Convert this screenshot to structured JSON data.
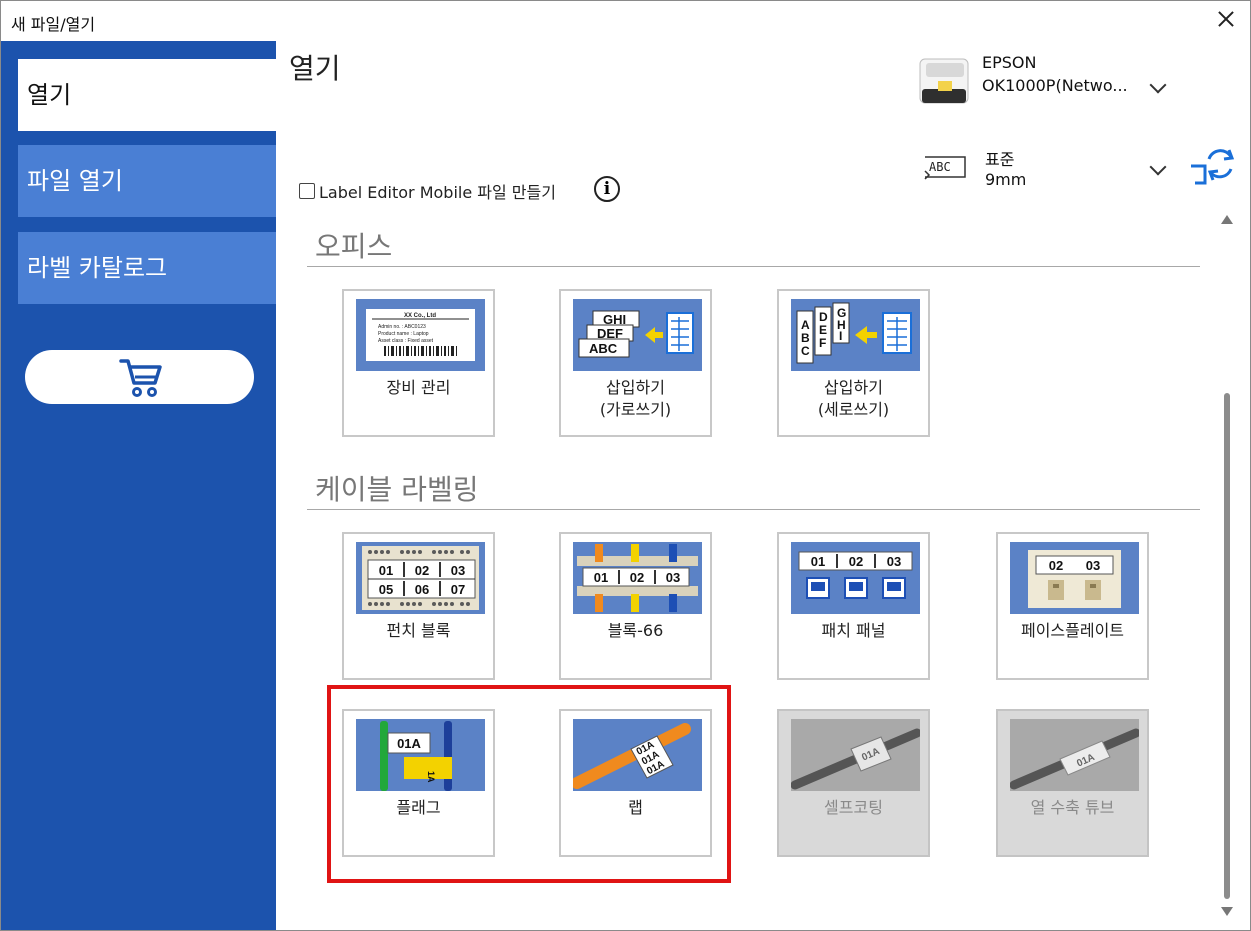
{
  "window": {
    "title": "새 파일/열기"
  },
  "sidebar": {
    "items": [
      {
        "label": "열기"
      },
      {
        "label": "파일 열기"
      },
      {
        "label": "라벨 카탈로그"
      }
    ]
  },
  "main": {
    "title": "열기",
    "printer": {
      "brand": "EPSON",
      "model": "OK1000P(Netwo..."
    },
    "tape": {
      "icon_text": "ABC",
      "type": "표준",
      "width": "9mm"
    },
    "label_editor_mobile": {
      "label": "Label Editor Mobile 파일 만들기",
      "checked": false
    },
    "sections": [
      {
        "title": "오피스",
        "tiles": [
          {
            "line1": "장비 관리",
            "line2": "",
            "enabled": true
          },
          {
            "line1": "삽입하기",
            "line2": "(가로쓰기)",
            "enabled": true
          },
          {
            "line1": "삽입하기",
            "line2": "(세로쓰기)",
            "enabled": true
          }
        ]
      },
      {
        "title": "케이블 라벨링",
        "tiles": [
          {
            "line1": "펀치 블록",
            "line2": "",
            "enabled": true
          },
          {
            "line1": "블록-66",
            "line2": "",
            "enabled": true
          },
          {
            "line1": "패치 패널",
            "line2": "",
            "enabled": true
          },
          {
            "line1": "페이스플레이트",
            "line2": "",
            "enabled": true
          },
          {
            "line1": "플래그",
            "line2": "",
            "enabled": true
          },
          {
            "line1": "랩",
            "line2": "",
            "enabled": true
          },
          {
            "line1": "셀프코팅",
            "line2": "",
            "enabled": false
          },
          {
            "line1": "열 수축 튜브",
            "line2": "",
            "enabled": false
          }
        ]
      }
    ],
    "thumb_text": {
      "asset_company": "XX Co., Ltd",
      "asset_row1": "Admin no.   : ABC0123",
      "asset_row2": "Product name : Laptop",
      "asset_row3": "Asset class  : Fixed asset",
      "insert_1": "GHI",
      "insert_2": "DEF",
      "insert_3": "ABC",
      "num_01": "01",
      "num_02": "02",
      "num_03": "03",
      "num_05": "05",
      "num_06": "06",
      "num_07": "07",
      "flag_text": "01A"
    }
  },
  "colors": {
    "sidebar_bg": "#1c53ad",
    "sidebar_item_bg": "#4a7fd4",
    "thumb_bg": "#5b82c6",
    "highlight": "#e01414",
    "accent": "#1a6fd8"
  }
}
